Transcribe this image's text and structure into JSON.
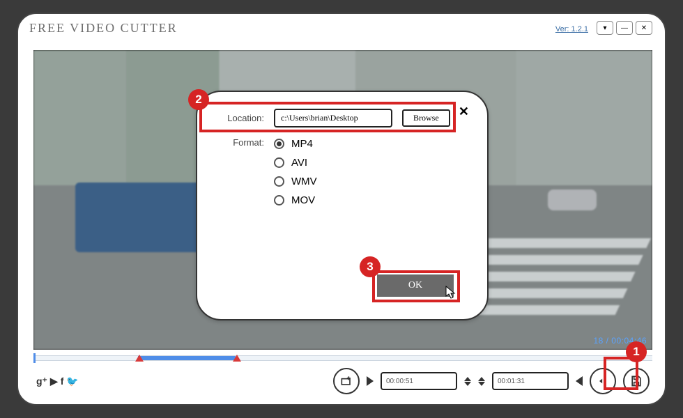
{
  "app": {
    "title": "FREE VIDEO CUTTER",
    "version": "Ver: 1.2.1"
  },
  "time": {
    "current": "18",
    "total": "00:04:46",
    "display": "18 / 00:04:46"
  },
  "range": {
    "start": "00:00:51",
    "end": "00:01:31"
  },
  "dialog": {
    "location_label": "Location:",
    "location_value": "c:\\Users\\brian\\Desktop",
    "browse_label": "Browse",
    "format_label": "Format:",
    "formats": [
      "MP4",
      "AVI",
      "WMV",
      "MOV"
    ],
    "selected_format": "MP4",
    "ok_label": "OK"
  },
  "callouts": {
    "1": "1",
    "2": "2",
    "3": "3"
  }
}
